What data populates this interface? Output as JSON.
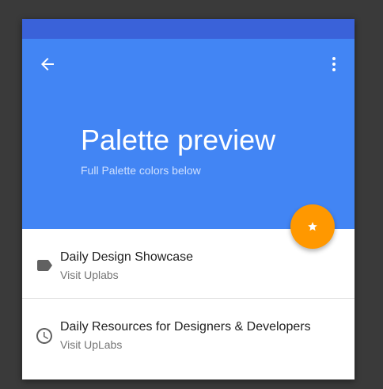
{
  "appbar": {
    "title": "Palette preview",
    "subtitle": "Full Palette colors below",
    "back_icon": "arrow-back-icon",
    "more_icon": "more-vert-icon"
  },
  "fab": {
    "icon": "star-icon",
    "color": "#ff9800"
  },
  "colors": {
    "primary": "#4285f4",
    "primary_dark": "#3a62d9",
    "accent": "#ff9800"
  },
  "list": {
    "items": [
      {
        "icon": "label-icon",
        "primary": "Daily Design Showcase",
        "secondary": "Visit Uplabs"
      },
      {
        "icon": "clock-icon",
        "primary": "Daily Resources for Designers & Developers",
        "secondary": "Visit UpLabs"
      }
    ]
  }
}
